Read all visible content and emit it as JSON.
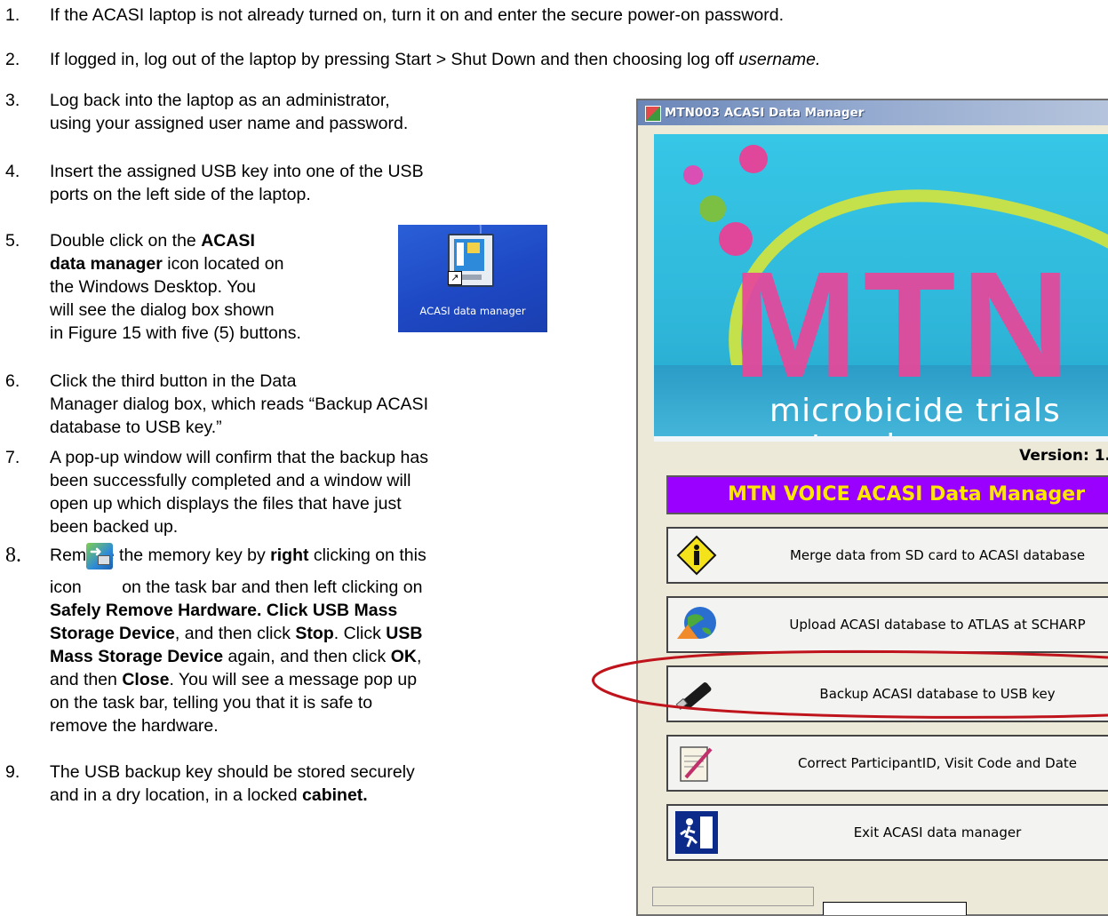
{
  "steps": {
    "s1": {
      "num": "1.",
      "text": "If the ACASI laptop is not already turned on, turn it on and enter the secure power-on password."
    },
    "s2": {
      "num": "2.",
      "text_a": "If logged in, log out of the laptop by pressing Start > Shut Down and then choosing log off ",
      "text_italic": "username."
    },
    "s3": {
      "num": "3.",
      "line1": "Log back into the laptop as an administrator,",
      "line2": "using your assigned user name and password."
    },
    "s4": {
      "num": "4.",
      "line1": "Insert the assigned USB key into one of the USB",
      "line2": "ports on the left side of the laptop."
    },
    "s5": {
      "num": "5.",
      "l1_a": "Double click on the ",
      "l1_b": "ACASI",
      "l2_b": "data manager",
      "l2_a": " icon located on",
      "l3": "the Windows Desktop.  You",
      "l4": "will see the dialog box shown",
      "l5": "in Figure 15 with five (5) buttons."
    },
    "s6": {
      "num": "6.",
      "line1": "Click the third button in the Data",
      "line2": "Manager dialog box, which reads “Backup ACASI",
      "line3": "database to USB key.”"
    },
    "s7": {
      "num": "7.",
      "line1": "A pop-up window will confirm that the backup has",
      "line2": "been successfully completed and a window will",
      "line3": "open up which displays the files that have just",
      "line4": "been backed up."
    },
    "s8": {
      "num": "8.",
      "l1_a": "Remove the memory key by ",
      "l1_b": "right",
      "l1_c": " clicking on this",
      "l2_a": "icon",
      "l2_b": " on the task bar and then left clicking on",
      "l3": "Safely Remove Hardware.  Click USB Mass",
      "l4_b": "Storage Device",
      "l4_a": ", and then click ",
      "l4_c": "Stop",
      "l4_d": ".  Click ",
      "l4_e": "USB",
      "l5_b": "Mass Storage Device",
      "l5_a": " again, and then click ",
      "l5_c": "OK",
      "l5_d": ",",
      "l6_a": "and then ",
      "l6_b": "Close",
      "l6_c": ".  You will see a message pop up",
      "l7": "on the task bar, telling you that it is safe to",
      "l8": "remove the hardware."
    },
    "s9": {
      "num": "9.",
      "line1": "The USB backup key should be stored securely",
      "line2_a": "and in a dry location, in a locked ",
      "line2_b": "cabinet."
    }
  },
  "desktop_icon": {
    "label": "ACASI data manager",
    "icon": "monitor-shortcut-icon"
  },
  "tray_icon": {
    "icon": "usb-safely-remove-icon"
  },
  "dialog": {
    "title": "MTN003 ACASI Data Manager",
    "logo_text": "MTN",
    "tagline": "microbicide trials network",
    "version_label": "Version: 1.",
    "app_title": "MTN VOICE ACASI Data Manager",
    "buttons": [
      {
        "label": "Merge data from SD card to ACASI database",
        "icon": "warning-sign-icon"
      },
      {
        "label": "Upload ACASI database to ATLAS at SCHARP",
        "icon": "globe-upload-icon"
      },
      {
        "label": "Backup ACASI database to USB key",
        "icon": "usb-key-icon"
      },
      {
        "label": "Correct ParticipantID, Visit Code and Date",
        "icon": "notepad-pen-icon"
      },
      {
        "label": "Exit ACASI data manager",
        "icon": "exit-door-icon"
      }
    ],
    "highlight_color": "#c0141c",
    "app_title_bg": "#9a00ff",
    "app_title_fg": "#ffe600"
  }
}
